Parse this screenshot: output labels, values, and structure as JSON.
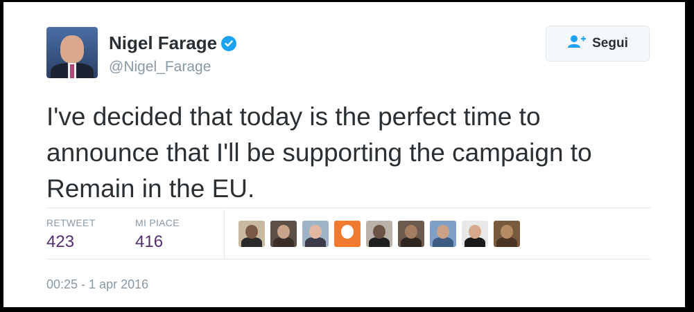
{
  "user": {
    "name": "Nigel Farage",
    "handle": "@Nigel_Farage",
    "verified": true
  },
  "follow_button": {
    "label": "Segui",
    "icon": "add-user-icon"
  },
  "tweet": {
    "text": "I've decided that today is the perfect time to announce that I'll be supporting the campaign to Remain in the EU."
  },
  "stats": {
    "retweet_label": "RETWEET",
    "retweet_count": "423",
    "like_label": "MI PIACE",
    "like_count": "416"
  },
  "likers": [
    {
      "name": "liker-1",
      "bg": "#c9b9a0",
      "head": "#7a5a44",
      "body": "#2a2a2a"
    },
    {
      "name": "liker-2",
      "bg": "#5c5046",
      "head": "#c8a58a",
      "body": "#3a2f28"
    },
    {
      "name": "liker-3",
      "bg": "#9fb3c6",
      "head": "#e3b8a2",
      "body": "#3b3b4a"
    },
    {
      "name": "liker-4",
      "bg": "#f27a2e",
      "head": "#ffffff",
      "body": "#f27a2e"
    },
    {
      "name": "liker-5",
      "bg": "#b9b2a8",
      "head": "#6b5446",
      "body": "#1f1f1f"
    },
    {
      "name": "liker-6",
      "bg": "#6b5a4d",
      "head": "#a57e62",
      "body": "#2e2620"
    },
    {
      "name": "liker-7",
      "bg": "#7fa0c7",
      "head": "#caa185",
      "body": "#3e5c82"
    },
    {
      "name": "liker-8",
      "bg": "#e8e8e8",
      "head": "#d6a98c",
      "body": "#1a1a1a"
    },
    {
      "name": "liker-9",
      "bg": "#7a5a3e",
      "head": "#b58b62",
      "body": "#4a3424"
    }
  ],
  "timestamp": "00:25 - 1 apr 2016",
  "colors": {
    "accent_link": "#1da1f2",
    "count_color": "#552f6d",
    "muted_text": "#8899a6"
  }
}
